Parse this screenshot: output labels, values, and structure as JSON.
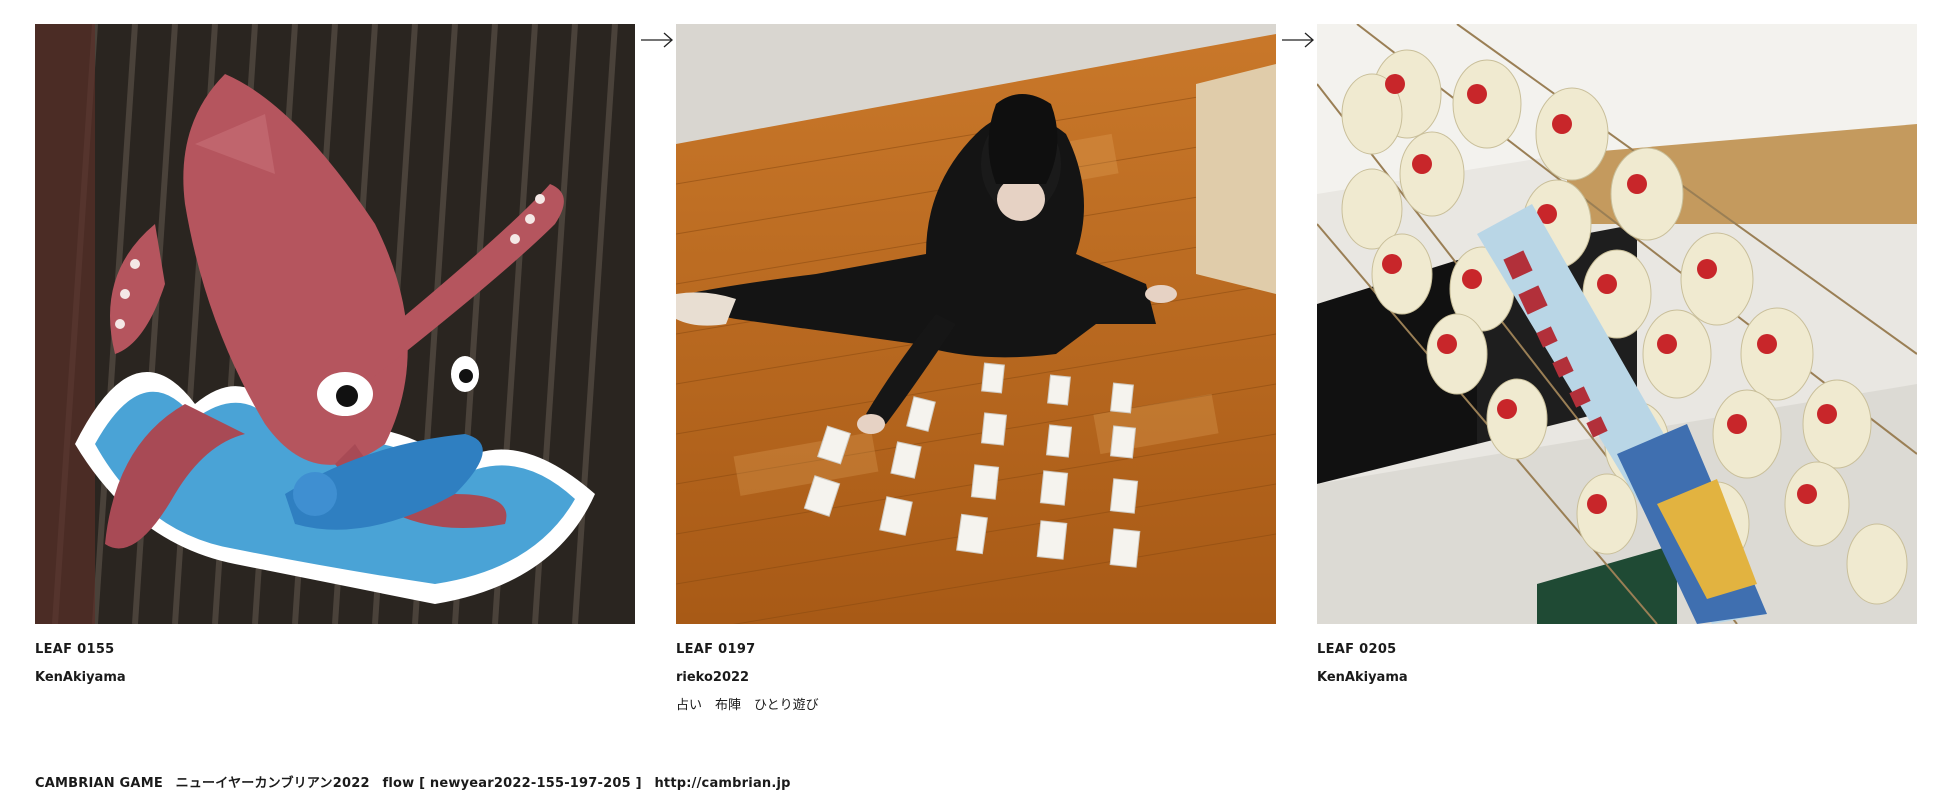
{
  "leaves": [
    {
      "title": "LEAF 0155",
      "author": "KenAkiyama",
      "memo": "",
      "image_subject": "squid-sculpture-photo"
    },
    {
      "title": "LEAF 0197",
      "author": "rieko2022",
      "memo": "占い　布陣　ひとり遊び",
      "image_subject": "fortune-cards-floor-photo"
    },
    {
      "title": "LEAF 0205",
      "author": "KenAkiyama",
      "memo": "",
      "image_subject": "lanterns-banner-photo"
    }
  ],
  "arrows": [
    "arrow-right-icon",
    "arrow-right-icon"
  ],
  "footer": {
    "site": "CAMBRIAN GAME",
    "event": "ニューイヤーカンブリアン2022",
    "flow": "flow [ newyear2022-155-197-205 ]",
    "url": "http://cambrian.jp"
  },
  "colors": {
    "text": "#1a1a1a",
    "background": "#ffffff",
    "squid_red": "#b5555e",
    "floor_wood": "#b5681e",
    "lantern_cream": "#f0ead0",
    "banner_blue": "#b9d6e6"
  }
}
